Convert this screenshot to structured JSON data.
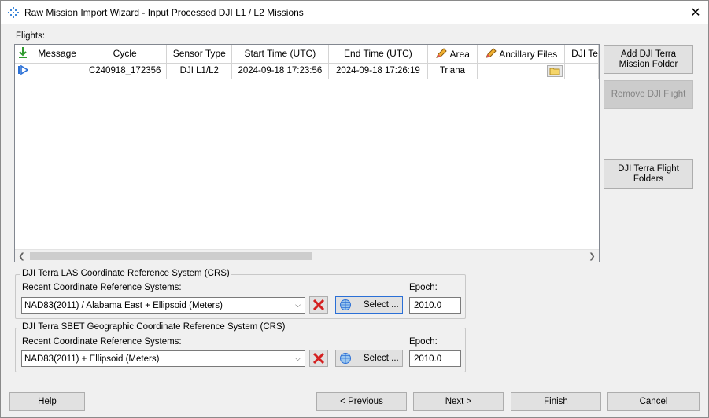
{
  "window": {
    "title": "Raw Mission Import Wizard - Input Processed DJI L1 / L2 Missions"
  },
  "flights": {
    "label": "Flights:",
    "columns": [
      "",
      "Message",
      "Cycle",
      "Sensor Type",
      "Start Time (UTC)",
      "End Time (UTC)",
      "Area",
      "Ancillary Files",
      "DJI Te"
    ],
    "rows": [
      {
        "message": "",
        "cycle": "C240918_172356",
        "sensor_type": "DJI L1/L2",
        "start_time": "2024-09-18 17:23:56",
        "end_time": "2024-09-18 17:26:19",
        "area": "Triana",
        "ancillary": ""
      }
    ]
  },
  "side_buttons": {
    "add_folder": "Add DJI Terra Mission Folder",
    "remove_flight": "Remove DJI Flight",
    "flight_folders": "DJI Terra Flight Folders"
  },
  "las_crs": {
    "legend": "DJI Terra LAS Coordinate Reference System (CRS)",
    "recent_label": "Recent Coordinate Reference Systems:",
    "selected": "NAD83(2011) / Alabama East + Ellipsoid (Meters)",
    "select_label": "Select ...",
    "epoch_label": "Epoch:",
    "epoch": "2010.0"
  },
  "sbet_crs": {
    "legend": "DJI Terra SBET Geographic Coordinate Reference System (CRS)",
    "recent_label": "Recent Coordinate Reference Systems:",
    "selected": "NAD83(2011) + Ellipsoid (Meters)",
    "select_label": "Select ...",
    "epoch_label": "Epoch:",
    "epoch": "2010.0"
  },
  "footer": {
    "help": "Help",
    "previous": "< Previous",
    "next": "Next >",
    "finish": "Finish",
    "cancel": "Cancel"
  },
  "colors": {
    "accent_blue": "#2a6fd6",
    "delete_red": "#d42020",
    "edit_orange": "#e0a020",
    "green_arrow": "#2e9b2e"
  }
}
